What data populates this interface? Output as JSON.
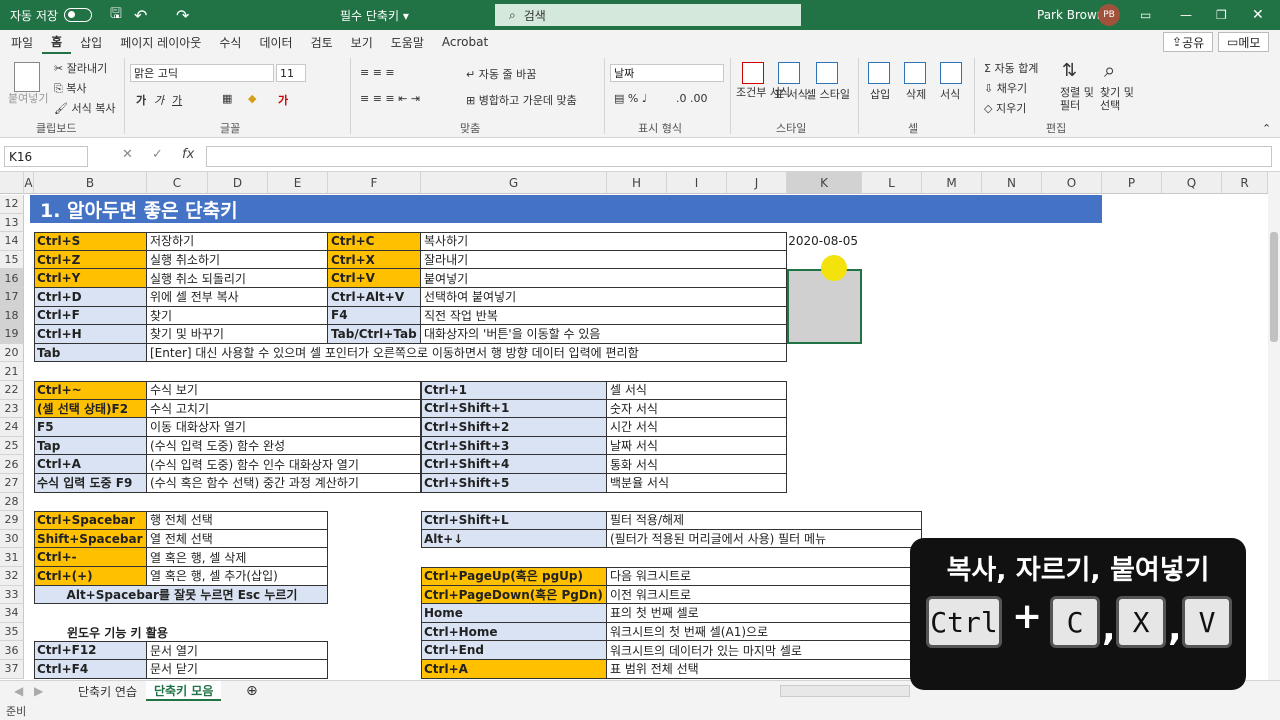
{
  "titlebar": {
    "autosave_label": "자동 저장",
    "doc_title": "필수 단축키 ▾",
    "search_placeholder": "검색",
    "user_name": "Park Brown",
    "user_initials": "PB"
  },
  "menu": [
    "파일",
    "홈",
    "삽입",
    "페이지 레이아웃",
    "수식",
    "데이터",
    "검토",
    "보기",
    "도움말",
    "Acrobat"
  ],
  "share": {
    "share_label": "공유",
    "memo_label": "메모"
  },
  "ribbon": {
    "paste": "붙여넣기",
    "cut": "잘라내기",
    "copy": "복사",
    "format_painter": "서식 복사",
    "clipboard": "클립보드",
    "font_name": "맑은 고딕",
    "font_size": "11",
    "font_group": "글꼴",
    "wrap": "자동 줄 바꿈",
    "merge": "병합하고 가운데 맞춤",
    "align_group": "맞춤",
    "number_format": "날짜",
    "number_group": "표시 형식",
    "cond_format": "조건부 서식",
    "table_format": "표 서식",
    "cell_style": "셀 스타일",
    "style_group": "스타일",
    "insert": "삽입",
    "delete": "삭제",
    "format": "서식",
    "cells_group": "셀",
    "autosum": "자동 합계",
    "fill": "채우기",
    "clear": "지우기",
    "sort": "정렬 및 필터",
    "find": "찾기 및 선택",
    "edit_group": "편집"
  },
  "formula": {
    "namebox": "K16",
    "fx": "fx"
  },
  "columns": [
    "A",
    "B",
    "C",
    "D",
    "E",
    "F",
    "G",
    "H",
    "I",
    "J",
    "K",
    "L",
    "M",
    "N",
    "O",
    "P",
    "Q",
    "R"
  ],
  "rows": [
    "12",
    "13",
    "14",
    "15",
    "16",
    "17",
    "18",
    "19",
    "20",
    "21",
    "22",
    "23",
    "24",
    "25",
    "26",
    "27",
    "28",
    "29",
    "30",
    "31",
    "32",
    "33",
    "34",
    "35",
    "36",
    "37"
  ],
  "banner": "1. 알아두면 좋은 단축키",
  "date_cell": "2020-08-05",
  "table1": [
    [
      "Ctrl+S",
      "저장하기",
      "Ctrl+C",
      "복사하기"
    ],
    [
      "Ctrl+Z",
      "실행 취소하기",
      "Ctrl+X",
      "잘라내기"
    ],
    [
      "Ctrl+Y",
      "실행 취소 되돌리기",
      "Ctrl+V",
      "붙여넣기"
    ],
    [
      "Ctrl+D",
      "위에 셀 전부 복사",
      "Ctrl+Alt+V",
      "선택하여 붙여넣기"
    ],
    [
      "Ctrl+F",
      "찾기",
      "F4",
      "직전 작업 반복"
    ],
    [
      "Ctrl+H",
      "찾기 및 바꾸기",
      "Tab/Ctrl+Tab",
      "대화상자의 '버튼'을 이동할 수 있음"
    ]
  ],
  "tab_row": [
    "Tab",
    "[Enter] 대신 사용할 수 있으며 셀 포인터가 오른쪽으로 이동하면서 행 방향 데이터 입력에 편리함"
  ],
  "table2": [
    [
      "Ctrl+~",
      "수식 보기"
    ],
    [
      "(셀 선택 상태)F2",
      "수식 고치기"
    ],
    [
      "F5",
      "이동 대화상자 열기"
    ],
    [
      "Tap",
      "(수식 입력 도중) 함수 완성"
    ],
    [
      "Ctrl+A",
      "(수식 입력 도중) 함수 인수 대화상자 열기"
    ],
    [
      "수식 입력 도중 F9",
      "(수식 혹은 함수 선택) 중간 과정 계산하기"
    ]
  ],
  "table3": [
    [
      "Ctrl+1",
      "셀 서식"
    ],
    [
      "Ctrl+Shift+1",
      "숫자 서식"
    ],
    [
      "Ctrl+Shift+2",
      "시간 서식"
    ],
    [
      "Ctrl+Shift+3",
      "날짜 서식"
    ],
    [
      "Ctrl+Shift+4",
      "통화 서식"
    ],
    [
      "Ctrl+Shift+5",
      "백분율 서식"
    ]
  ],
  "table4": [
    [
      "Ctrl+Spacebar",
      "행 전체 선택"
    ],
    [
      "Shift+Spacebar",
      "열 전체 선택"
    ],
    [
      "Ctrl+-",
      "열 혹은 행, 셀 삭제"
    ],
    [
      "Ctrl+(+)",
      "열 혹은 행, 셀 추가(삽입)"
    ]
  ],
  "alt_note": "Alt+Spacebar를 잘못 누르면 Esc 누르기",
  "window_heading": "윈도우 기능 키 활용",
  "table5": [
    [
      "Ctrl+F12",
      "문서 열기"
    ],
    [
      "Ctrl+F4",
      "문서 닫기"
    ]
  ],
  "table6": [
    [
      "Ctrl+Shift+L",
      "필터 적용/해제"
    ],
    [
      "Alt+↓",
      "(필터가 적용된 머리글에서 사용) 필터 메뉴"
    ]
  ],
  "table7": [
    [
      "Ctrl+PageUp(혹은 pgUp)",
      "다음 워크시트로"
    ],
    [
      "Ctrl+PageDown(혹은 PgDn)",
      "이전 워크시트로"
    ],
    [
      "Home",
      "표의 첫 번째 셀로"
    ],
    [
      "Ctrl+Home",
      "워크시트의 첫 번째 셀(A1)으로"
    ],
    [
      "Ctrl+End",
      "워크시트의 데이터가 있는 마지막 셀로"
    ],
    [
      "Ctrl+A",
      "표 범위 전체 선택"
    ]
  ],
  "sheets": [
    "단축키 연습",
    "단축키 모음"
  ],
  "status": "준비",
  "overlay": {
    "title": "복사, 자르기, 붙여넣기",
    "keys": [
      "Ctrl",
      "C",
      "X",
      "V"
    ],
    "plus": "+",
    "comma": ","
  }
}
